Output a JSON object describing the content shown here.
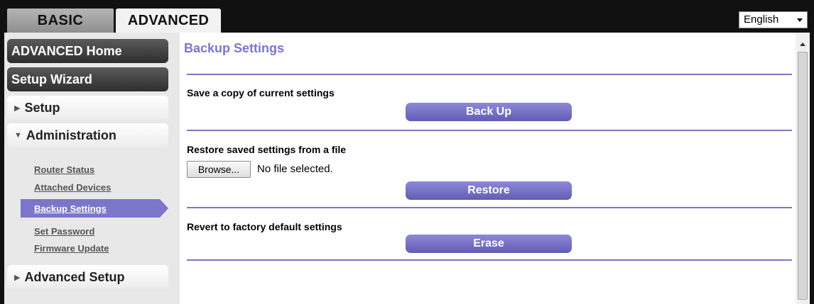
{
  "tabs": {
    "basic": "BASIC",
    "advanced": "ADVANCED"
  },
  "language": {
    "selected": "English"
  },
  "sidebar": {
    "advanced_home": "ADVANCED Home",
    "setup_wizard": "Setup Wizard",
    "setup": "Setup",
    "administration": "Administration",
    "admin_items": [
      "Router Status",
      "Attached Devices",
      "Backup Settings",
      "Set Password",
      "Firmware Update"
    ],
    "advanced_setup": "Advanced Setup"
  },
  "main": {
    "title": "Backup Settings",
    "save_label": "Save a copy of current settings",
    "backup_button": "Back Up",
    "restore_label": "Restore saved settings from a file",
    "browse_button": "Browse...",
    "no_file": "No file selected.",
    "restore_button": "Restore",
    "revert_label": "Revert to factory default settings",
    "erase_button": "Erase"
  },
  "colors": {
    "accent": "#7b76c9",
    "topbar": "#111111"
  }
}
